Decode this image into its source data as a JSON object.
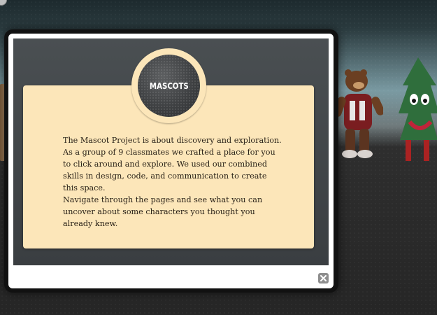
{
  "modal": {
    "badge_title": "MASCOTS",
    "paragraphs": [
      "The Mascot Project is about discovery and exploration. As a group of 9 classmates we crafted a place for you to click around and explore. We used our combined skills in design, code, and communication to create this space.",
      "Navigate through the pages and see what you can uncover about some characters you thought you already knew."
    ],
    "close_icon": "close-icon"
  },
  "colors": {
    "card": "#fce6b9",
    "panel": "#43484b",
    "badge": "#4a4c4e"
  }
}
